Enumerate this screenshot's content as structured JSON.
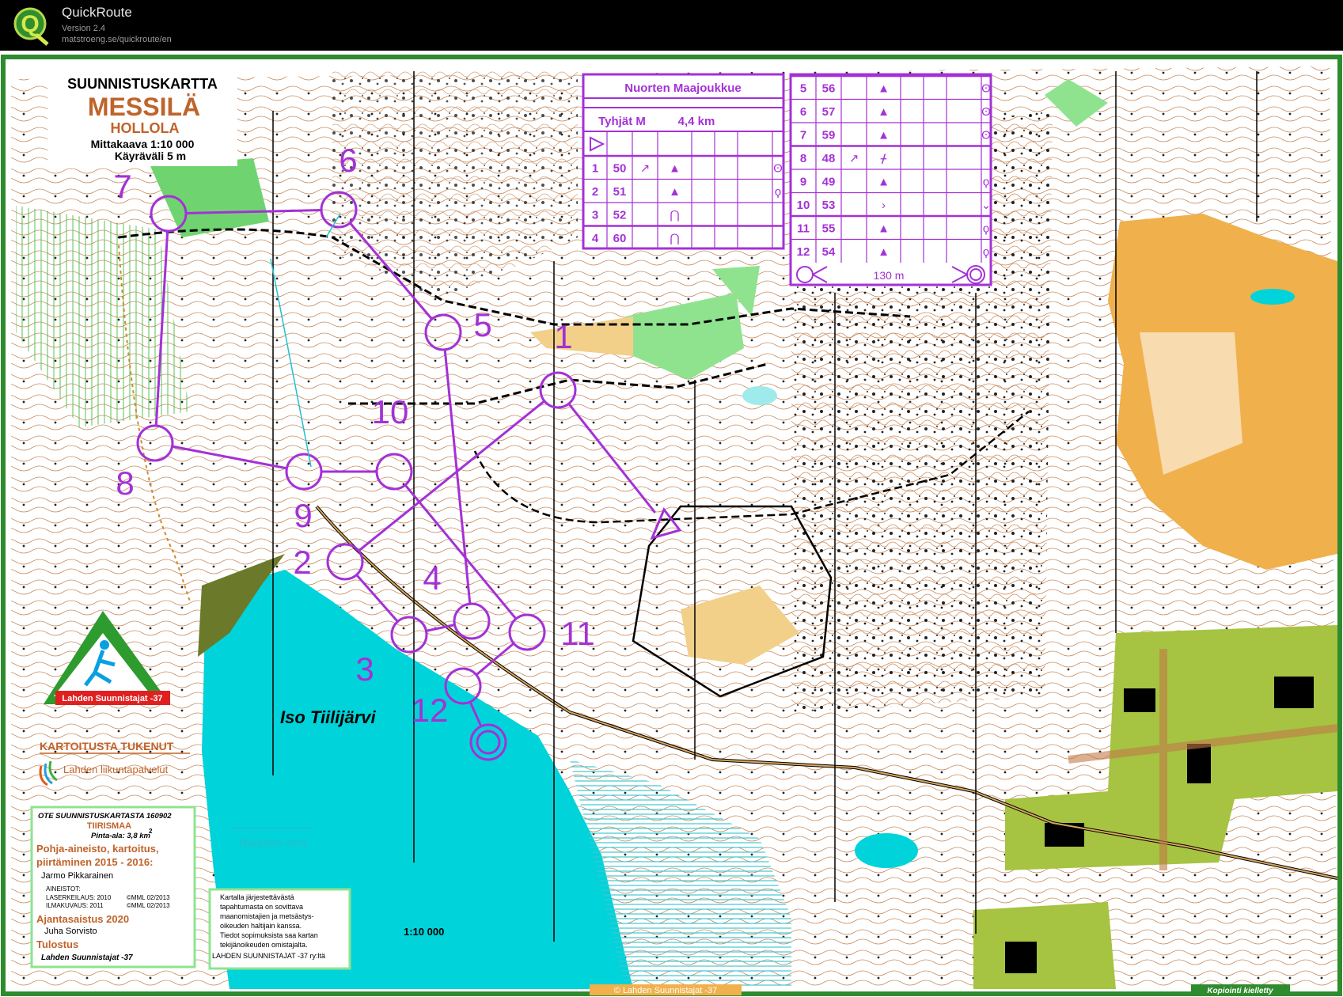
{
  "app": {
    "name": "QuickRoute",
    "version": "Version 2.4",
    "url": "matstroeng.se/quickroute/en",
    "logo_letter": "Q"
  },
  "map": {
    "title": "SUUNNISTUSKARTTA",
    "name": "MESSILÄ",
    "municipality": "HOLLOLA",
    "scale_line": "Mittakaava 1:10 000",
    "contour_line": "Käyräväli 5 m",
    "lake_name": "Iso Tiilijärvi",
    "scale_bottom": "1:10 000",
    "womens_legs": "Naisten oiot",
    "copyright": "© Lahden Suunnistajat -37",
    "no_copying": "Kopiointi kielletty"
  },
  "club_logo": {
    "text": "Lahden Suunnistajat -37"
  },
  "sponsor": {
    "heading": "KARTOITUSTA TUKENUT",
    "name": "Lahden liikuntapalvelut"
  },
  "map_info": {
    "line1": "OTE SUUNNISTUSKARTASTA 160902",
    "area_name": "TIIRISMAA",
    "area": "Pinta-ala: 3,8 km",
    "area_sup": "2",
    "heading1a": "Pohja-aineisto, kartoitus,",
    "heading1b": "piirtäminen 2015 - 2016:",
    "mapper": "Jarmo Pikkarainen",
    "materials": "AINEISTOT:",
    "laser": "LASERKEILAUS: 2010",
    "laser_src": "©MML 02/2013",
    "aerial": "ILMAKUVAUS: 2011",
    "aerial_src": "©MML 02/2013",
    "heading2": "Ajantasaistus 2020",
    "updater": "Juha Sorvisto",
    "heading3": "Tulostus",
    "printer": "Lahden Suunnistajat -37"
  },
  "notice": {
    "lines": [
      "Kartalla  järjestettävästä",
      "tapahtumasta on sovittava",
      "maanomistajien ja metsästys-",
      "oikeuden haltijain kanssa.",
      "Tiedot sopimuksista saa kartan",
      "tekijänoikeuden omistajalta.",
      "LAHDEN SUUNNISTAJAT -37 ry:ltä"
    ]
  },
  "course": {
    "event": "Nuorten Maajoukkue",
    "class": "Tyhjät M",
    "length": "4,4 km",
    "finish_distance": "130 m",
    "color": "#a431d6",
    "controls_left": [
      {
        "num": "1",
        "code": "50",
        "dir": "↗",
        "feature": "▲",
        "loc": "ʘ"
      },
      {
        "num": "2",
        "code": "51",
        "dir": "",
        "feature": "▲",
        "loc": "ϙ"
      },
      {
        "num": "3",
        "code": "52",
        "dir": "",
        "feature": "⋂",
        "loc": ""
      },
      {
        "num": "4",
        "code": "60",
        "dir": "",
        "feature": "⋂",
        "loc": ""
      }
    ],
    "controls_right": [
      {
        "num": "5",
        "code": "56",
        "dir": "",
        "feature": "▲",
        "loc": "ʘ"
      },
      {
        "num": "6",
        "code": "57",
        "dir": "",
        "feature": "▲",
        "loc": "ʘ"
      },
      {
        "num": "7",
        "code": "59",
        "dir": "",
        "feature": "▲",
        "loc": "ʘ"
      },
      {
        "num": "8",
        "code": "48",
        "dir": "↗",
        "feature": "ᚋ",
        "loc": ""
      },
      {
        "num": "9",
        "code": "49",
        "dir": "",
        "feature": "▲",
        "loc": "ϙ"
      },
      {
        "num": "10",
        "code": "53",
        "dir": "",
        "feature": "›",
        "loc": "⌄"
      },
      {
        "num": "11",
        "code": "55",
        "dir": "",
        "feature": "▲",
        "loc": "ϙ"
      },
      {
        "num": "12",
        "code": "54",
        "dir": "",
        "feature": "▲",
        "loc": "ϙ"
      }
    ],
    "control_labels": [
      "1",
      "2",
      "3",
      "4",
      "5",
      "6",
      "7",
      "8",
      "9",
      "10",
      "11",
      "12"
    ]
  }
}
